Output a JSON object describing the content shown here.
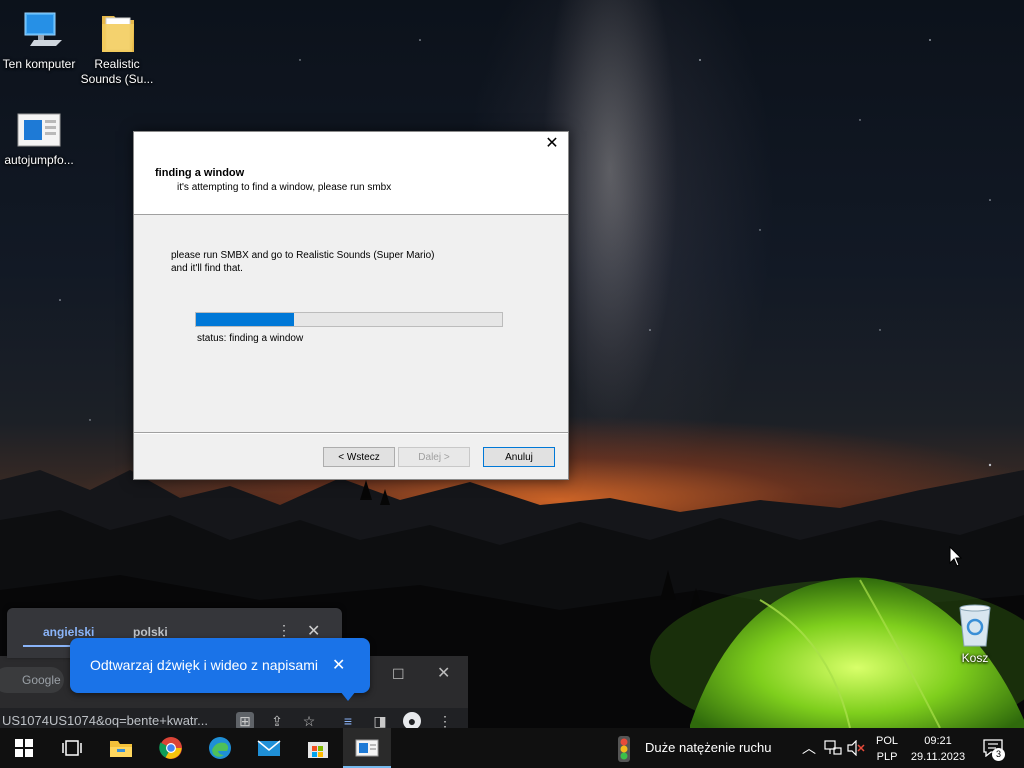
{
  "desktop": {
    "icons": [
      {
        "label": "Ten komputer",
        "icon": "computer-icon"
      },
      {
        "label": "Realistic Sounds (Su...",
        "icon": "folder-icon"
      },
      {
        "label": "autojumpfo...",
        "icon": "app-window-icon"
      },
      {
        "label": "Kosz",
        "icon": "recycle-bin-icon"
      }
    ]
  },
  "dialog": {
    "close_glyph": "✕",
    "title": "finding a window",
    "subtitle": "it's attempting to find a window, please run smbx",
    "message_line1": "please run SMBX and go to Realistic Sounds (Super Mario)",
    "message_line2": "and it'll find that.",
    "progress": 0.32,
    "status": "status: finding a window",
    "buttons": {
      "back": "< Wstecz",
      "next": "Dalej >",
      "cancel": "Anuluj"
    }
  },
  "browser": {
    "translate_tabs": [
      "angielski",
      "polski"
    ],
    "caption_toast": "Odtwarzaj dźwięk i wideo z napisami",
    "search_placeholder": "Google",
    "address": "US1074US1074&oq=bente+kwatr..."
  },
  "taskbar": {
    "pinned": [
      "start-icon",
      "task-view-icon",
      "file-explorer-icon",
      "chrome-icon",
      "edge-icon",
      "mail-icon",
      "store-icon",
      "wizard-app-icon"
    ],
    "traffic": "Duże natężenie ruchu",
    "language_top": "POL",
    "language_bottom": "PLP",
    "time": "09:21",
    "date": "29.11.2023",
    "notifications": "3"
  },
  "colors": {
    "accent": "#0078d7",
    "toast": "#1a73e8",
    "taskbar": "#101010"
  }
}
